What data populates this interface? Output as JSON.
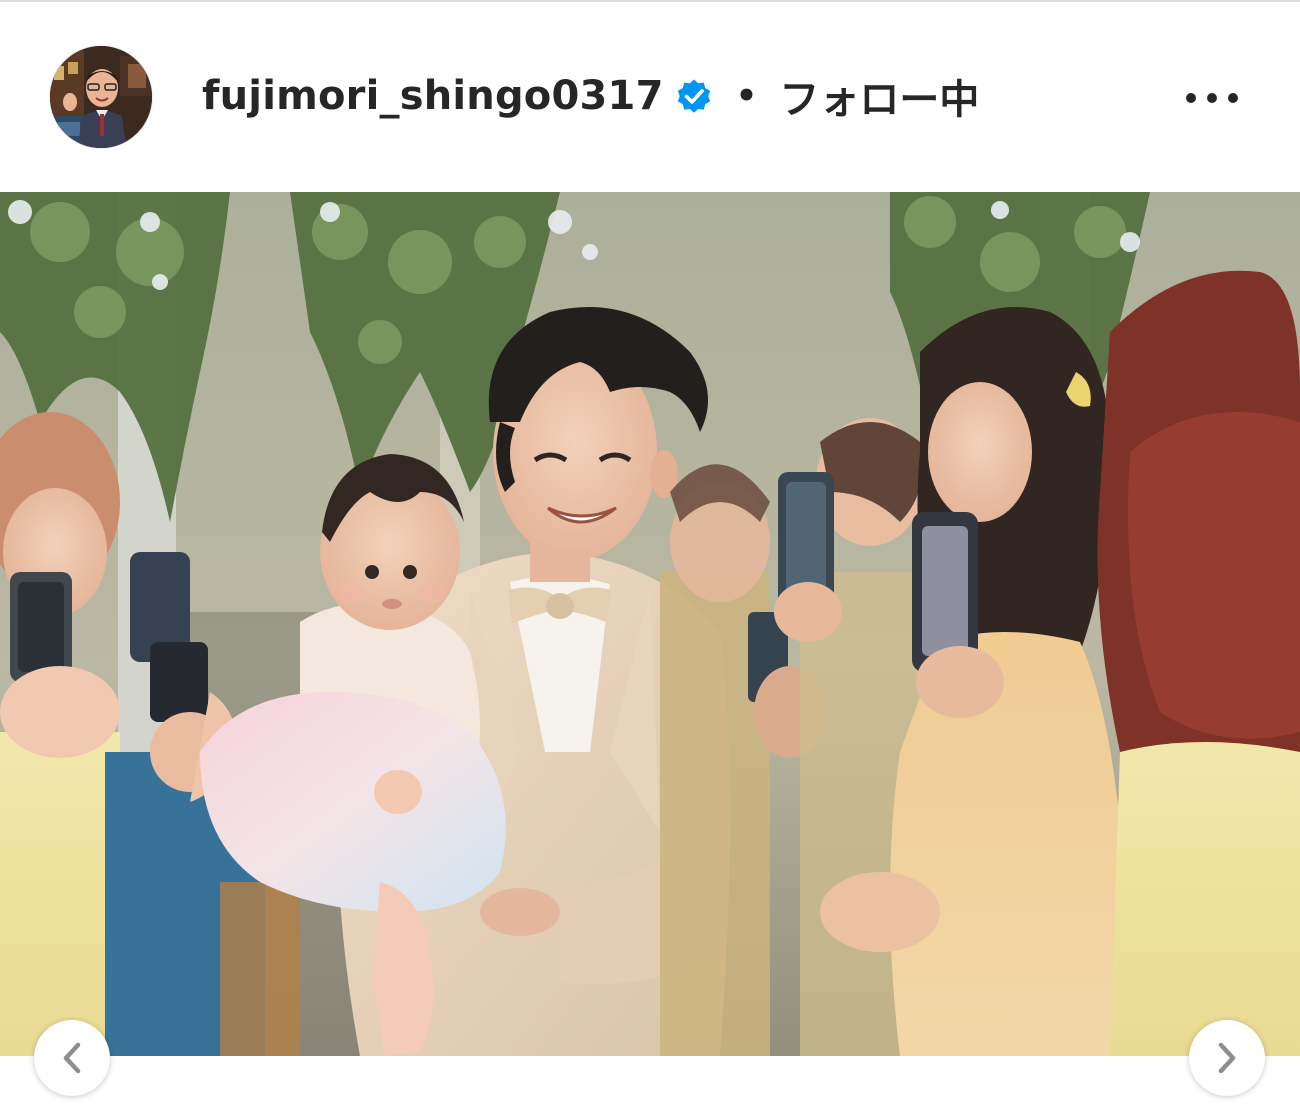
{
  "post": {
    "author": {
      "username": "fujimori_shingo0317",
      "verified": true,
      "avatar_icon": "profile-avatar"
    },
    "separator": "•",
    "follow_status": "フォロー中",
    "more_icon": "more-options-icon",
    "image": {
      "alt_subject": "smiling-man-holding-baby-at-wedding"
    },
    "carousel": {
      "prev_icon": "chevron-left-icon",
      "next_icon": "chevron-right-icon"
    }
  },
  "colors": {
    "verified_badge": "#0095f6",
    "text": "#262626",
    "icon_gray": "#8e8e8e"
  }
}
